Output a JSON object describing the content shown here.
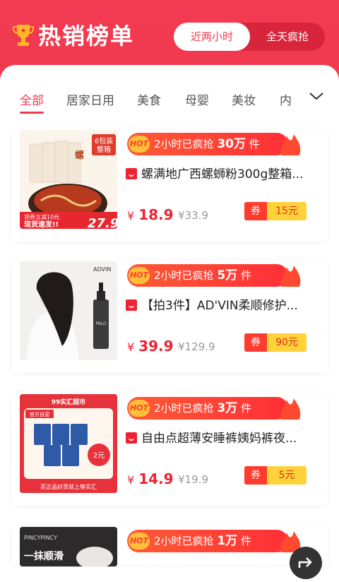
{
  "header": {
    "title": "热销榜单",
    "toggle": {
      "active": "近两小时",
      "inactive": "全天疯抢"
    }
  },
  "tabs": [
    "全部",
    "居家日用",
    "美食",
    "母婴",
    "美妆",
    "内"
  ],
  "hot": {
    "badge": "HOT",
    "prefix": "2小时已疯抢",
    "suffix": "件"
  },
  "coupon_label": "券",
  "currency": "¥",
  "products": [
    {
      "name": "螺满地广西螺蛳粉300g整箱...",
      "sold": "30万",
      "price": "18.9",
      "orig": "¥33.9",
      "coupon": "15元",
      "thumb": {
        "corner_tag": "6包装\n整箱",
        "promo": "领券立减10元",
        "promo2": "现货速发!!",
        "price": "27.9"
      }
    },
    {
      "name": "【拍3件】AD'VIN柔顺修护...",
      "sold": "5万",
      "price": "39.9",
      "orig": "¥129.9",
      "coupon": "90元",
      "thumb": {
        "brand": "ADVIN"
      }
    },
    {
      "name": "自由点超薄安睡裤姨妈裤夜...",
      "sold": "3万",
      "price": "14.9",
      "orig": "¥19.9",
      "coupon": "5元",
      "thumb": {
        "top": "99实汇超市",
        "store": "官方自营",
        "bottom": "买正品好货就上够实汇"
      }
    },
    {
      "name": "",
      "sold": "1万",
      "price": "",
      "orig": "",
      "coupon": "",
      "thumb": {
        "brand": "PINCYPINCY",
        "text": "一抹顺滑"
      }
    }
  ],
  "colors": {
    "brand_red": "#ee3b4f",
    "price_red": "#ee2233",
    "coupon_yellow": "#ffd23a"
  }
}
